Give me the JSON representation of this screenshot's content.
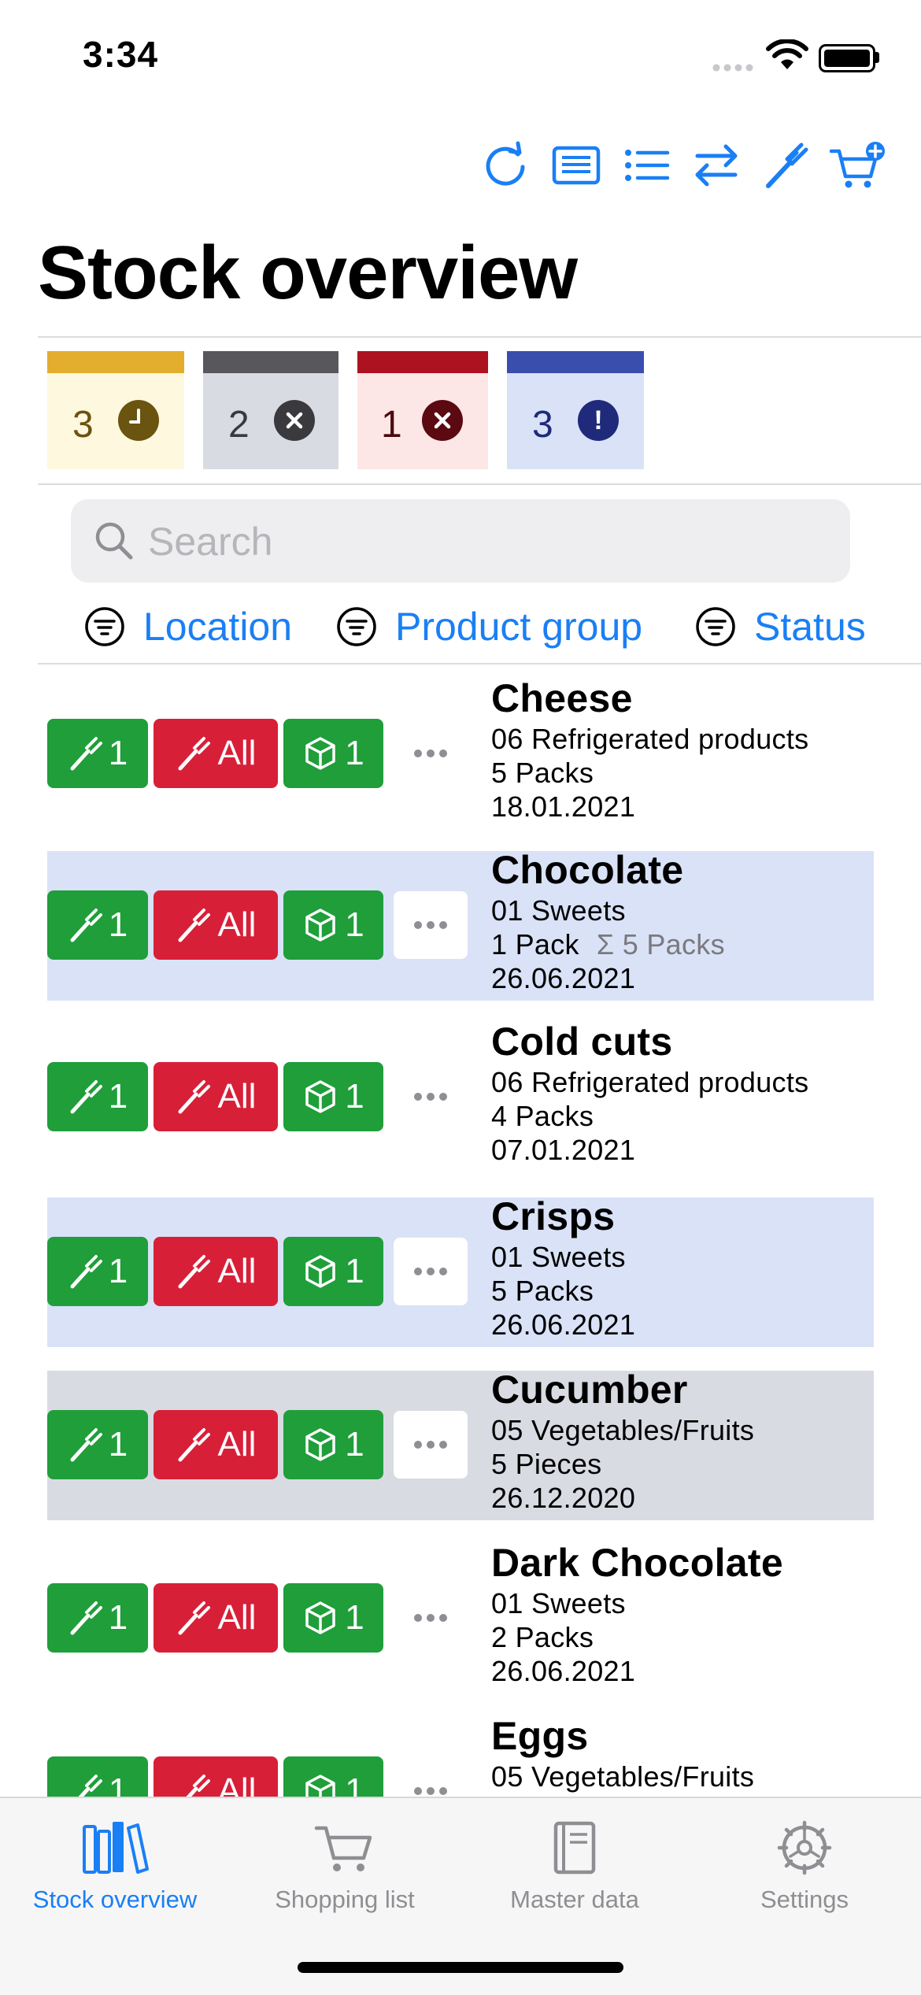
{
  "status_bar": {
    "time": "3:34"
  },
  "page_title": "Stock overview",
  "toolbar": {
    "icons": [
      "refresh-icon",
      "journal-icon",
      "list-icon",
      "transfer-icon",
      "fork-icon",
      "cart-add-icon"
    ],
    "accent": "#1a7ff5"
  },
  "summary": [
    {
      "count": "3",
      "kind": "due-soon",
      "color": "#e3ae2e",
      "bg": "#fdf8de"
    },
    {
      "count": "2",
      "kind": "expired",
      "color": "#58585c",
      "bg": "#d9dbe2"
    },
    {
      "count": "1",
      "kind": "overdue",
      "color": "#ad1220",
      "bg": "#fde6e6"
    },
    {
      "count": "3",
      "kind": "below-min-stock",
      "color": "#3a4eae",
      "bg": "#dae2f7"
    }
  ],
  "search": {
    "placeholder": "Search",
    "value": ""
  },
  "filters": {
    "location": "Location",
    "product_group": "Product group",
    "status": "Status"
  },
  "actions": {
    "consume_one": "1",
    "consume_all": "All",
    "open_one": "1"
  },
  "products": [
    {
      "name": "Cheese",
      "group": "06 Refrigerated products",
      "amount": "5 Packs",
      "sum": "",
      "date": "18.01.2021",
      "highlight": "none"
    },
    {
      "name": "Chocolate",
      "group": "01 Sweets",
      "amount": "1 Pack",
      "sum": "Σ 5 Packs",
      "date": "26.06.2021",
      "highlight": "blue"
    },
    {
      "name": "Cold cuts",
      "group": "06 Refrigerated products",
      "amount": "4 Packs",
      "sum": "",
      "date": "07.01.2021",
      "highlight": "none"
    },
    {
      "name": "Crisps",
      "group": "01 Sweets",
      "amount": "5 Packs",
      "sum": "",
      "date": "26.06.2021",
      "highlight": "blue"
    },
    {
      "name": "Cucumber",
      "group": "05 Vegetables/Fruits",
      "amount": "5 Pieces",
      "sum": "",
      "date": "26.12.2020",
      "highlight": "gray"
    },
    {
      "name": "Dark Chocolate",
      "group": "01 Sweets",
      "amount": "2 Packs",
      "sum": "",
      "date": "26.06.2021",
      "highlight": "none"
    },
    {
      "name": "Eggs",
      "group": "05 Vegetables/Fruits",
      "amount": "",
      "sum": "",
      "date": "",
      "highlight": "none"
    }
  ],
  "tabs": [
    {
      "label": "Stock overview",
      "icon": "books-icon",
      "active": true
    },
    {
      "label": "Shopping list",
      "icon": "cart-icon",
      "active": false
    },
    {
      "label": "Master data",
      "icon": "book-icon",
      "active": false
    },
    {
      "label": "Settings",
      "icon": "gear-icon",
      "active": false
    }
  ]
}
